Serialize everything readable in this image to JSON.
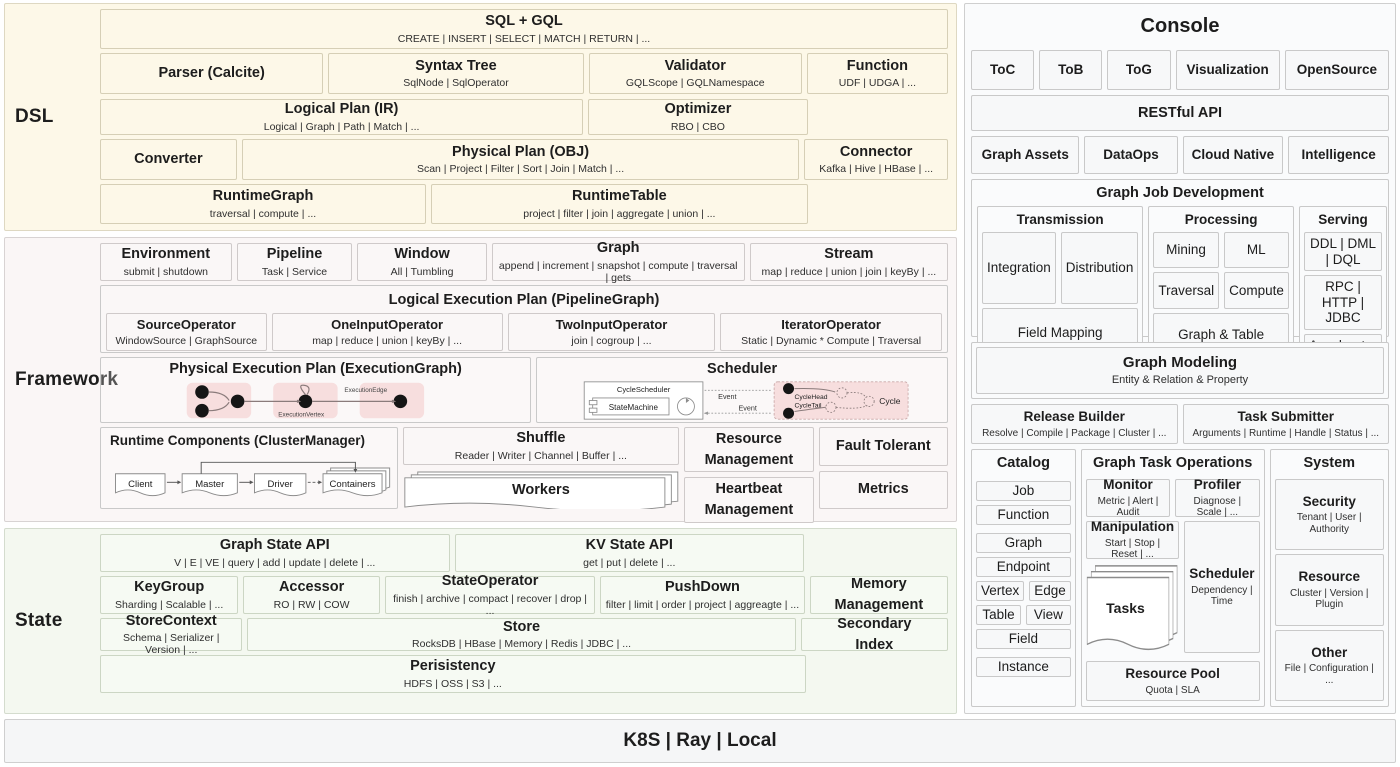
{
  "colors": {
    "dsl_bg": "#fdf8e8",
    "framework_bg": "#faf6f6",
    "state_bg": "#f4f8f0",
    "console_bg": "#fafbfc",
    "accent_pink": "#f7dede"
  },
  "dsl": {
    "label": "DSL",
    "sql_gql": {
      "title": "SQL + GQL",
      "sub": "CREATE | INSERT | SELECT | MATCH | RETURN | ..."
    },
    "parser": {
      "title": "Parser (Calcite)",
      "sub": ""
    },
    "syntax_tree": {
      "title": "Syntax Tree",
      "sub": "SqlNode | SqlOperator"
    },
    "validator": {
      "title": "Validator",
      "sub": "GQLScope | GQLNamespace"
    },
    "function": {
      "title": "Function",
      "sub": "UDF | UDGA | ..."
    },
    "logical_plan": {
      "title": "Logical Plan (IR)",
      "sub": "Logical | Graph | Path | Match | ..."
    },
    "optimizer": {
      "title": "Optimizer",
      "sub": "RBO | CBO"
    },
    "converter": {
      "title": "Converter",
      "sub": ""
    },
    "physical_plan": {
      "title": "Physical Plan (OBJ)",
      "sub": "Scan | Project | Filter | Sort | Join | Match | ..."
    },
    "connector": {
      "title": "Connector",
      "sub": "Kafka | Hive | HBase | ..."
    },
    "runtime_graph": {
      "title": "RuntimeGraph",
      "sub": "traversal | compute | ..."
    },
    "runtime_table": {
      "title": "RuntimeTable",
      "sub": "project | filter | join | aggregate | union | ..."
    }
  },
  "framework": {
    "label": "Framework",
    "environment": {
      "title": "Environment",
      "sub": "submit | shutdown"
    },
    "pipeline": {
      "title": "Pipeline",
      "sub": "Task | Service"
    },
    "window": {
      "title": "Window",
      "sub": "All | Tumbling"
    },
    "graph": {
      "title": "Graph",
      "sub": "append | increment | snapshot | compute | traversal | gets"
    },
    "stream": {
      "title": "Stream",
      "sub": "map | reduce | union | join | keyBy | ..."
    },
    "logical_exec_plan": {
      "title": "Logical Execution Plan (PipelineGraph)"
    },
    "source_operator": {
      "title": "SourceOperator",
      "sub": "WindowSource | GraphSource"
    },
    "one_input_operator": {
      "title": "OneInputOperator",
      "sub": "map | reduce | union | keyBy | ..."
    },
    "two_input_operator": {
      "title": "TwoInputOperator",
      "sub": "join | cogroup | ..."
    },
    "iterator_operator": {
      "title": "IteratorOperator",
      "sub": "Static | Dynamic * Compute | Traversal"
    },
    "physical_exec_plan": {
      "title": "Physical Execution Plan (ExecutionGraph)",
      "labels": {
        "edge": "ExecutionEdge",
        "vertex": "ExecutionVertex"
      }
    },
    "scheduler": {
      "title": "Scheduler",
      "cycle_scheduler": "CycleScheduler",
      "state_machine": "StateMachine",
      "event1": "Event",
      "event2": "Event",
      "cycle_head": "CycleHead",
      "cycle_tail": "CycleTail",
      "cycle": "Cycle"
    },
    "runtime_components": {
      "title": "Runtime Components (ClusterManager)",
      "nodes": [
        "Client",
        "Master",
        "Driver",
        "Containers"
      ]
    },
    "shuffle": {
      "title": "Shuffle",
      "sub": "Reader | Writer | Channel | Buffer | ..."
    },
    "workers": {
      "title": "Workers"
    },
    "resource_management": {
      "line1": "Resource",
      "line2": "Management"
    },
    "fault_tolerant": {
      "title": "Fault Tolerant"
    },
    "heartbeat_management": {
      "line1": "Heartbeat",
      "line2": "Management"
    },
    "metrics": {
      "title": "Metrics"
    }
  },
  "state": {
    "label": "State",
    "graph_state_api": {
      "title": "Graph State API",
      "sub": "V | E | VE | query | add | update | delete | ..."
    },
    "kv_state_api": {
      "title": "KV State API",
      "sub": "get | put | delete | ..."
    },
    "keygroup": {
      "title": "KeyGroup",
      "sub": "Sharding | Scalable | ..."
    },
    "accessor": {
      "title": "Accessor",
      "sub": "RO | RW | COW"
    },
    "state_operator": {
      "title": "StateOperator",
      "sub": "finish | archive | compact | recover | drop | ..."
    },
    "pushdown": {
      "title": "PushDown",
      "sub": "filter | limit | order | project | aggreagte | ..."
    },
    "memory_management": {
      "line1": "Memory",
      "line2": "Management"
    },
    "store_context": {
      "title": "StoreContext",
      "sub": "Schema | Serializer | Version | ..."
    },
    "store": {
      "title": "Store",
      "sub": "RocksDB | HBase | Memory | Redis | JDBC | ..."
    },
    "secondary_index": {
      "line1": "Secondary",
      "line2": "Index"
    },
    "persistency": {
      "title": "Perisistency",
      "sub": "HDFS | OSS | S3 | ..."
    }
  },
  "console": {
    "title": "Console",
    "tabs": [
      "ToC",
      "ToB",
      "ToG",
      "Visualization",
      "OpenSource"
    ],
    "restful_api": "RESTful API",
    "capabilities": [
      "Graph Assets",
      "DataOps",
      "Cloud Native",
      "Intelligence"
    ],
    "graph_job_development": {
      "title": "Graph Job Development",
      "transmission": {
        "title": "Transmission",
        "items": [
          "Integration",
          "Distribution"
        ],
        "wide": "Field Mapping"
      },
      "processing": {
        "title": "Processing",
        "items": [
          "Mining",
          "ML",
          "Traversal",
          "Compute"
        ],
        "wide": "Graph & Table"
      },
      "serving": {
        "title": "Serving",
        "items": [
          "DDL | DML | DQL",
          "RPC | HTTP | JDBC",
          "Accelerator"
        ]
      }
    },
    "graph_modeling": {
      "title": "Graph Modeling",
      "sub": "Entity & Relation & Property"
    },
    "release_builder": {
      "title": "Release Builder",
      "sub": "Resolve | Compile | Package | Cluster | ..."
    },
    "task_submitter": {
      "title": "Task Submitter",
      "sub": "Arguments | Runtime | Handle | Status | ..."
    },
    "catalog": {
      "title": "Catalog",
      "items": [
        "Job",
        "Function",
        "Graph",
        "Endpoint",
        "Vertex",
        "Edge",
        "Table",
        "View",
        "Field",
        "Instance"
      ]
    },
    "graph_task_operations": {
      "title": "Graph Task Operations",
      "monitor": {
        "title": "Monitor",
        "sub": "Metric | Alert | Audit"
      },
      "profiler": {
        "title": "Profiler",
        "sub": "Diagnose | Scale | ..."
      },
      "manipulation": {
        "title": "Manipulation",
        "sub": "Start | Stop | Reset | ..."
      },
      "scheduler": {
        "title": "Scheduler",
        "sub": "Dependency | Time"
      },
      "tasks": {
        "title": "Tasks"
      },
      "resource_pool": {
        "title": "Resource Pool",
        "sub": "Quota | SLA"
      }
    },
    "system": {
      "title": "System",
      "security": {
        "title": "Security",
        "sub": "Tenant | User | Authority"
      },
      "resource": {
        "title": "Resource",
        "sub": "Cluster | Version | Plugin"
      },
      "other": {
        "title": "Other",
        "sub": "File | Configuration | ..."
      }
    }
  },
  "footer": {
    "title": "K8S | Ray | Local"
  }
}
